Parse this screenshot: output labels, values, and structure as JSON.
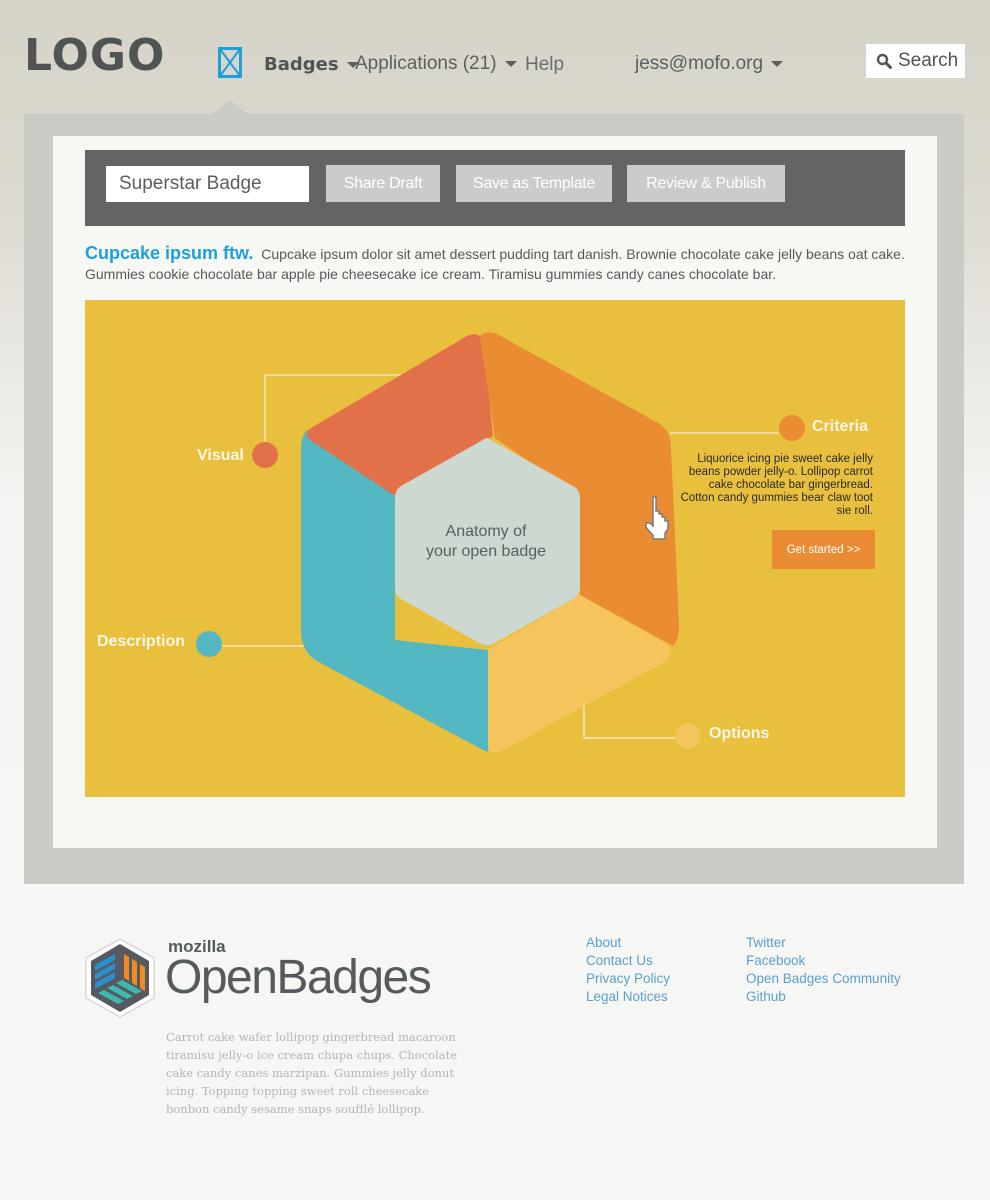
{
  "header": {
    "logo": "LOGO",
    "nav": {
      "badges_label": "Badges",
      "applications_label": "Applications (21)",
      "help_label": "Help",
      "user_label": "jess@mofo.org",
      "search_label": "Search"
    }
  },
  "toolbar": {
    "badge_name_value": "Superstar Badge",
    "share_draft_label": "Share Draft",
    "save_template_label": "Save as Template",
    "review_publish_label": "Review & Publish"
  },
  "intro": {
    "title": "Cupcake ipsum ftw.",
    "body": "Cupcake ipsum dolor sit amet dessert pudding tart danish. Brownie chocolate cake jelly beans oat cake. Gummies cookie chocolate bar apple pie cheesecake ice cream. Tiramisu gummies candy canes chocolate bar."
  },
  "infographic": {
    "center_line1": "Anatomy of",
    "center_line2": "your open badge",
    "labels": {
      "visual": "Visual",
      "description": "Description",
      "criteria": "Criteria",
      "options": "Options"
    },
    "criteria_text": "Liquorice icing pie sweet cake jelly beans powder jelly-o. Lollipop carrot cake chocolate bar gingerbread. Cotton candy gummies bear claw toot sie roll.",
    "cta_label": "Get started >>",
    "colors": {
      "background": "#e9c03d",
      "visual": "#e27048",
      "criteria": "#e98c32",
      "description": "#54b8c3",
      "options": "#f6c45c",
      "center": "#cdd8d0"
    }
  },
  "footer": {
    "brand_small": "mozilla",
    "brand_large": "OpenBadges",
    "description": "Carrot cake wafer lollipop gingerbread macaroon tiramisu jelly-o ice cream chupa chups. Chocolate cake candy canes marzipan. Gummies jelly donut icing. Topping topping sweet roll cheesecake bonbon candy sesame snaps soufflé lollipop.",
    "links_col1": [
      "About",
      "Contact Us",
      "Privacy Policy",
      "Legal Notices"
    ],
    "links_col2": [
      "Twitter",
      "Facebook",
      "Open Badges Community",
      "Github"
    ]
  }
}
